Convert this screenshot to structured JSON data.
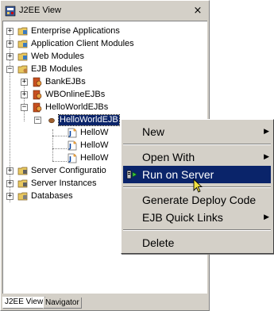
{
  "window": {
    "title": "J2EE View",
    "close_glyph": "×",
    "title_icon": "j2ee-view-icon"
  },
  "tree": [
    {
      "id": "enterprise-applications",
      "label": "Enterprise Applications",
      "expander": "+",
      "icon": "folder-icon"
    },
    {
      "id": "application-client-modules",
      "label": "Application Client Modules",
      "expander": "+",
      "icon": "folder-icon"
    },
    {
      "id": "web-modules",
      "label": "Web Modules",
      "expander": "+",
      "icon": "folder-icon"
    },
    {
      "id": "ejb-modules",
      "label": "EJB Modules",
      "expander": "−",
      "icon": "folder-icon"
    },
    {
      "id": "bankejbs",
      "label": "BankEJBs",
      "expander": "+",
      "icon": "ejb-jar-icon"
    },
    {
      "id": "wbonlineejbs",
      "label": "WBOnlineEJBs",
      "expander": "+",
      "icon": "ejb-jar-icon"
    },
    {
      "id": "helloworldejbs",
      "label": "HelloWorldEJBs",
      "expander": "−",
      "icon": "ejb-jar-icon"
    },
    {
      "id": "helloworldejb",
      "label": "HelloWorldEJB",
      "expander": "−",
      "icon": "bean-icon",
      "selected": true
    },
    {
      "id": "child-1",
      "label": "HelloW",
      "icon": "java-class-icon"
    },
    {
      "id": "child-2",
      "label": "HelloW",
      "icon": "java-class-icon"
    },
    {
      "id": "child-3",
      "label": "HelloW",
      "icon": "java-class-icon"
    },
    {
      "id": "server-configurations",
      "label": "Server Configuratio",
      "expander": "+",
      "icon": "folder-icon"
    },
    {
      "id": "server-instances",
      "label": "Server Instances",
      "expander": "+",
      "icon": "folder-icon"
    },
    {
      "id": "databases",
      "label": "Databases",
      "expander": "+",
      "icon": "database-icon"
    }
  ],
  "tabs": [
    {
      "label": "J2EE View",
      "active": true
    },
    {
      "label": "Navigator",
      "active": false
    }
  ],
  "context_menu": {
    "items": [
      {
        "label": "New",
        "submenu": true
      },
      {
        "label": "Open With",
        "submenu": true
      },
      {
        "label": "Run on Server",
        "highlighted": true,
        "icon": "run-on-server-icon"
      },
      {
        "label": "Generate Deploy Code"
      },
      {
        "label": "EJB Quick Links",
        "submenu": true
      },
      {
        "label": "Delete"
      }
    ],
    "submenu_glyph": "▶"
  },
  "colors": {
    "selection": "#0a246a",
    "chrome": "#d4d0c8",
    "folder": "#e8c860"
  }
}
